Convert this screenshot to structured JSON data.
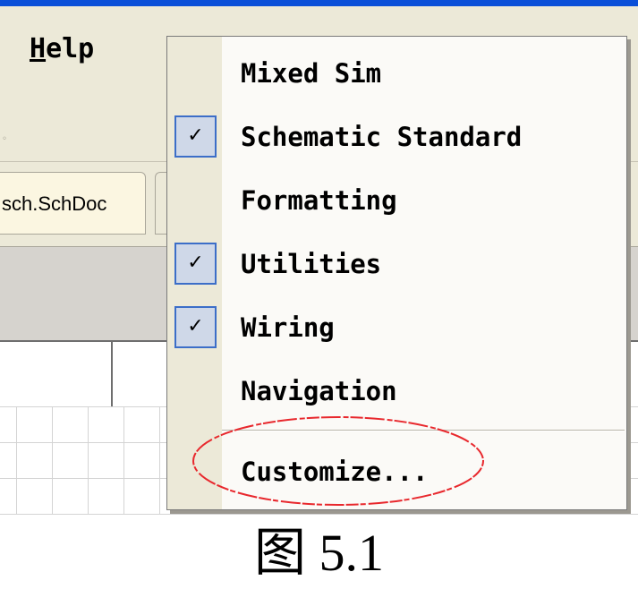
{
  "menubar": {
    "help_label": "Help",
    "help_label_first": "H",
    "help_label_rest": "elp"
  },
  "document_tab": {
    "label": "sch.SchDoc"
  },
  "toolbars_menu": {
    "items": [
      {
        "label": "Mixed Sim",
        "checked": false
      },
      {
        "label": "Schematic Standard",
        "checked": true
      },
      {
        "label": "Formatting",
        "checked": false
      },
      {
        "label": "Utilities",
        "checked": true
      },
      {
        "label": "Wiring",
        "checked": true
      },
      {
        "label": "Navigation",
        "checked": false
      }
    ],
    "customize_label": "Customize...",
    "check_glyph": "✓"
  },
  "annotation": {
    "ellipse_color": "#e8282d"
  },
  "figure_caption": "图 5.1",
  "colors": {
    "title_bar": "#0a4fd8",
    "menu_background": "#ece9d8",
    "check_highlight": "#cfd8e8",
    "check_border": "#3c6ec8"
  }
}
